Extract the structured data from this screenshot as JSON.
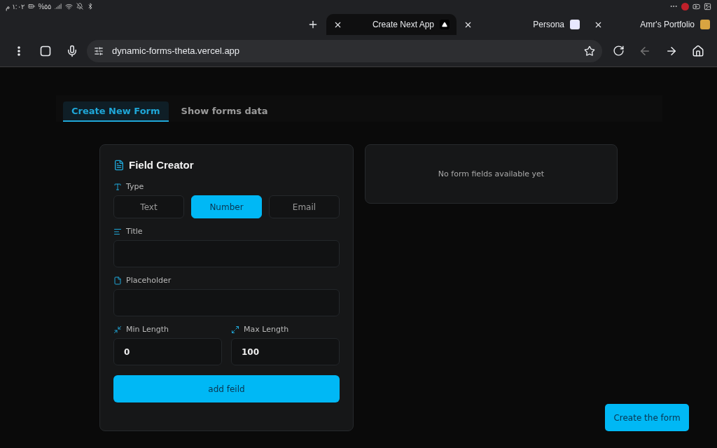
{
  "status_bar": {
    "time": "١:٠٢ م",
    "battery": "%٥٥"
  },
  "browser": {
    "tabs": [
      {
        "title": "Create Next App",
        "selected": true
      },
      {
        "title": "Persona",
        "selected": false
      },
      {
        "title": "Amr's Portfolio",
        "selected": false
      }
    ],
    "url": "dynamic-forms-theta.vercel.app"
  },
  "page": {
    "tabs": [
      {
        "label": "Create New Form",
        "selected": true
      },
      {
        "label": "Show forms data",
        "selected": false
      }
    ],
    "field_creator": {
      "title": "Field Creator",
      "type_label": "Type",
      "types": [
        {
          "label": "Text",
          "selected": false
        },
        {
          "label": "Number",
          "selected": true
        },
        {
          "label": "Email",
          "selected": false
        }
      ],
      "title_label": "Title",
      "placeholder_label": "Placeholder",
      "min_label": "Min Length",
      "min_value": "0",
      "max_label": "Max Length",
      "max_value": "100",
      "add_button": "add feild"
    },
    "preview": {
      "empty_text": "No form fields available yet"
    },
    "create_button": "Create the form"
  }
}
